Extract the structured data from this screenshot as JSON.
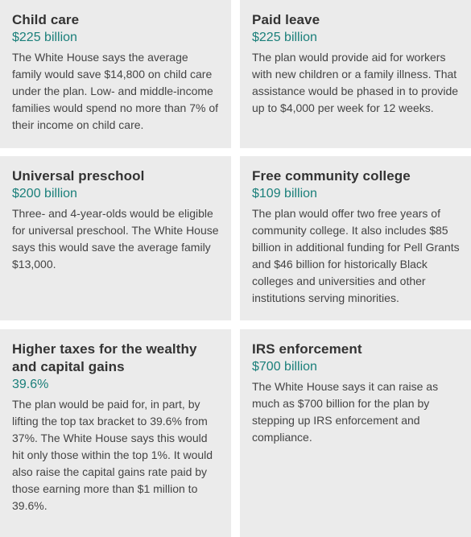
{
  "cards": [
    {
      "title": "Child care",
      "amount": "$225 billion",
      "body": "The White House says the average family would save $14,800 on child care under the plan. Low- and middle-income families would spend no more than 7% of their income on child care."
    },
    {
      "title": "Paid leave",
      "amount": "$225 billion",
      "body": "The plan would provide aid for workers with new children or a family illness. That assistance would be phased in to provide up to $4,000 per week for 12 weeks."
    },
    {
      "title": "Universal preschool",
      "amount": "$200 billion",
      "body": "Three- and 4-year-olds would be eligible for universal preschool. The White House says this would save the average family $13,000."
    },
    {
      "title": "Free community college",
      "amount": "$109 billion",
      "body": "The plan would offer two free years of community college. It also includes $85 billion in additional funding for Pell Grants and $46 billion for historically Black colleges and universities and other institutions serving minorities."
    },
    {
      "title": "Higher taxes for the wealthy and capital gains",
      "amount": "39.6%",
      "body": "The plan would be paid for, in part, by lifting the top tax bracket to 39.6% from 37%. The White House says this would hit only those within the top 1%. It would also raise the capital gains rate paid by those earning more than $1 million to 39.6%."
    },
    {
      "title": "IRS enforcement",
      "amount": "$700 billion",
      "body": "The White House says it can raise as much as $700 billion for the plan by stepping up IRS enforcement and compliance."
    }
  ]
}
